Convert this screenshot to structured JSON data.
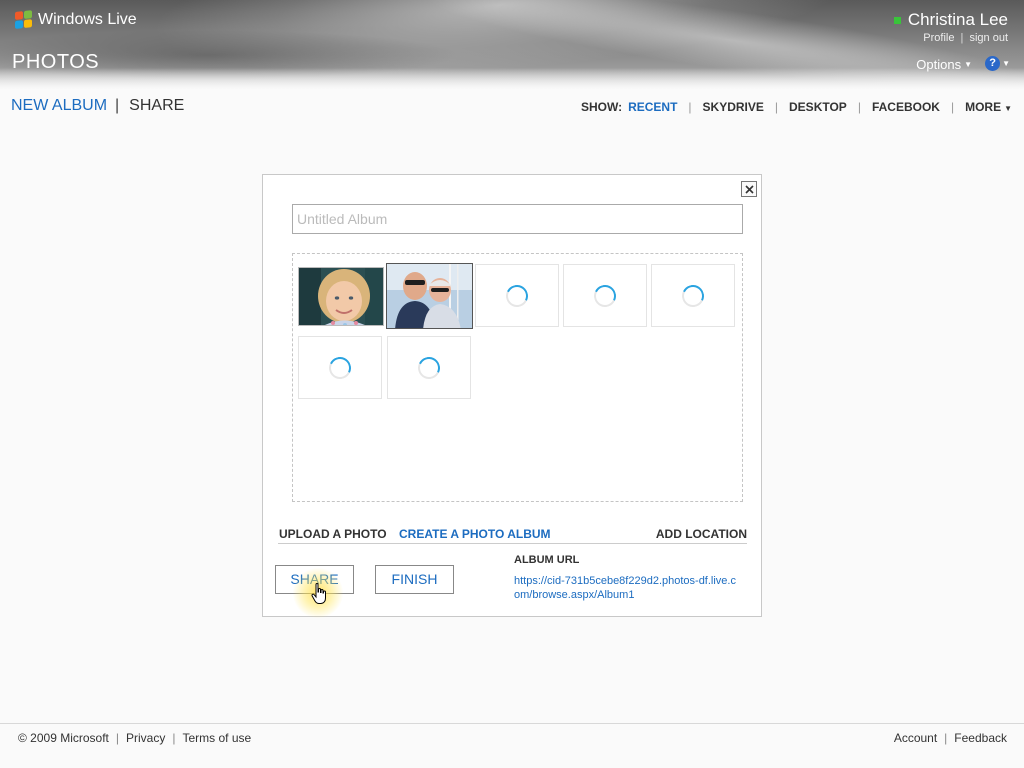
{
  "brand": {
    "name": "Windows Live",
    "app": "PHOTOS"
  },
  "user": {
    "name": "Christina Lee",
    "status_color": "#39c43a",
    "profile": "Profile",
    "sign_out": "sign out",
    "separator": "|"
  },
  "options": {
    "label": "Options"
  },
  "help": {
    "label": "?"
  },
  "subnav": {
    "new_album": "NEW ALBUM",
    "share": "SHARE",
    "show_label": "SHOW:",
    "sources": [
      "RECENT",
      "SKYDRIVE",
      "DESKTOP",
      "FACEBOOK"
    ],
    "more": "MORE",
    "active_source": "RECENT"
  },
  "dialog": {
    "title_placeholder": "Untitled Album",
    "upload": "UPLOAD A PHOTO",
    "create": "CREATE A PHOTO ALBUM",
    "add_location": "ADD LOCATION",
    "share_button": "SHARE",
    "finish_button": "FINISH",
    "url_label": "ALBUM URL",
    "url_value": "https://cid-731b5cebe8f229d2.photos-df.live.com/browse.aspx/Album1",
    "loaded_photos": [
      "girl-portrait",
      "two-men-boat"
    ],
    "loading_count": 5
  },
  "footer": {
    "copyright": "© 2009 Microsoft",
    "privacy": "Privacy",
    "terms": "Terms of use",
    "account": "Account",
    "feedback": "Feedback"
  },
  "colors": {
    "accent": "#1c6cc0",
    "spinner": "#2aa3e0"
  }
}
